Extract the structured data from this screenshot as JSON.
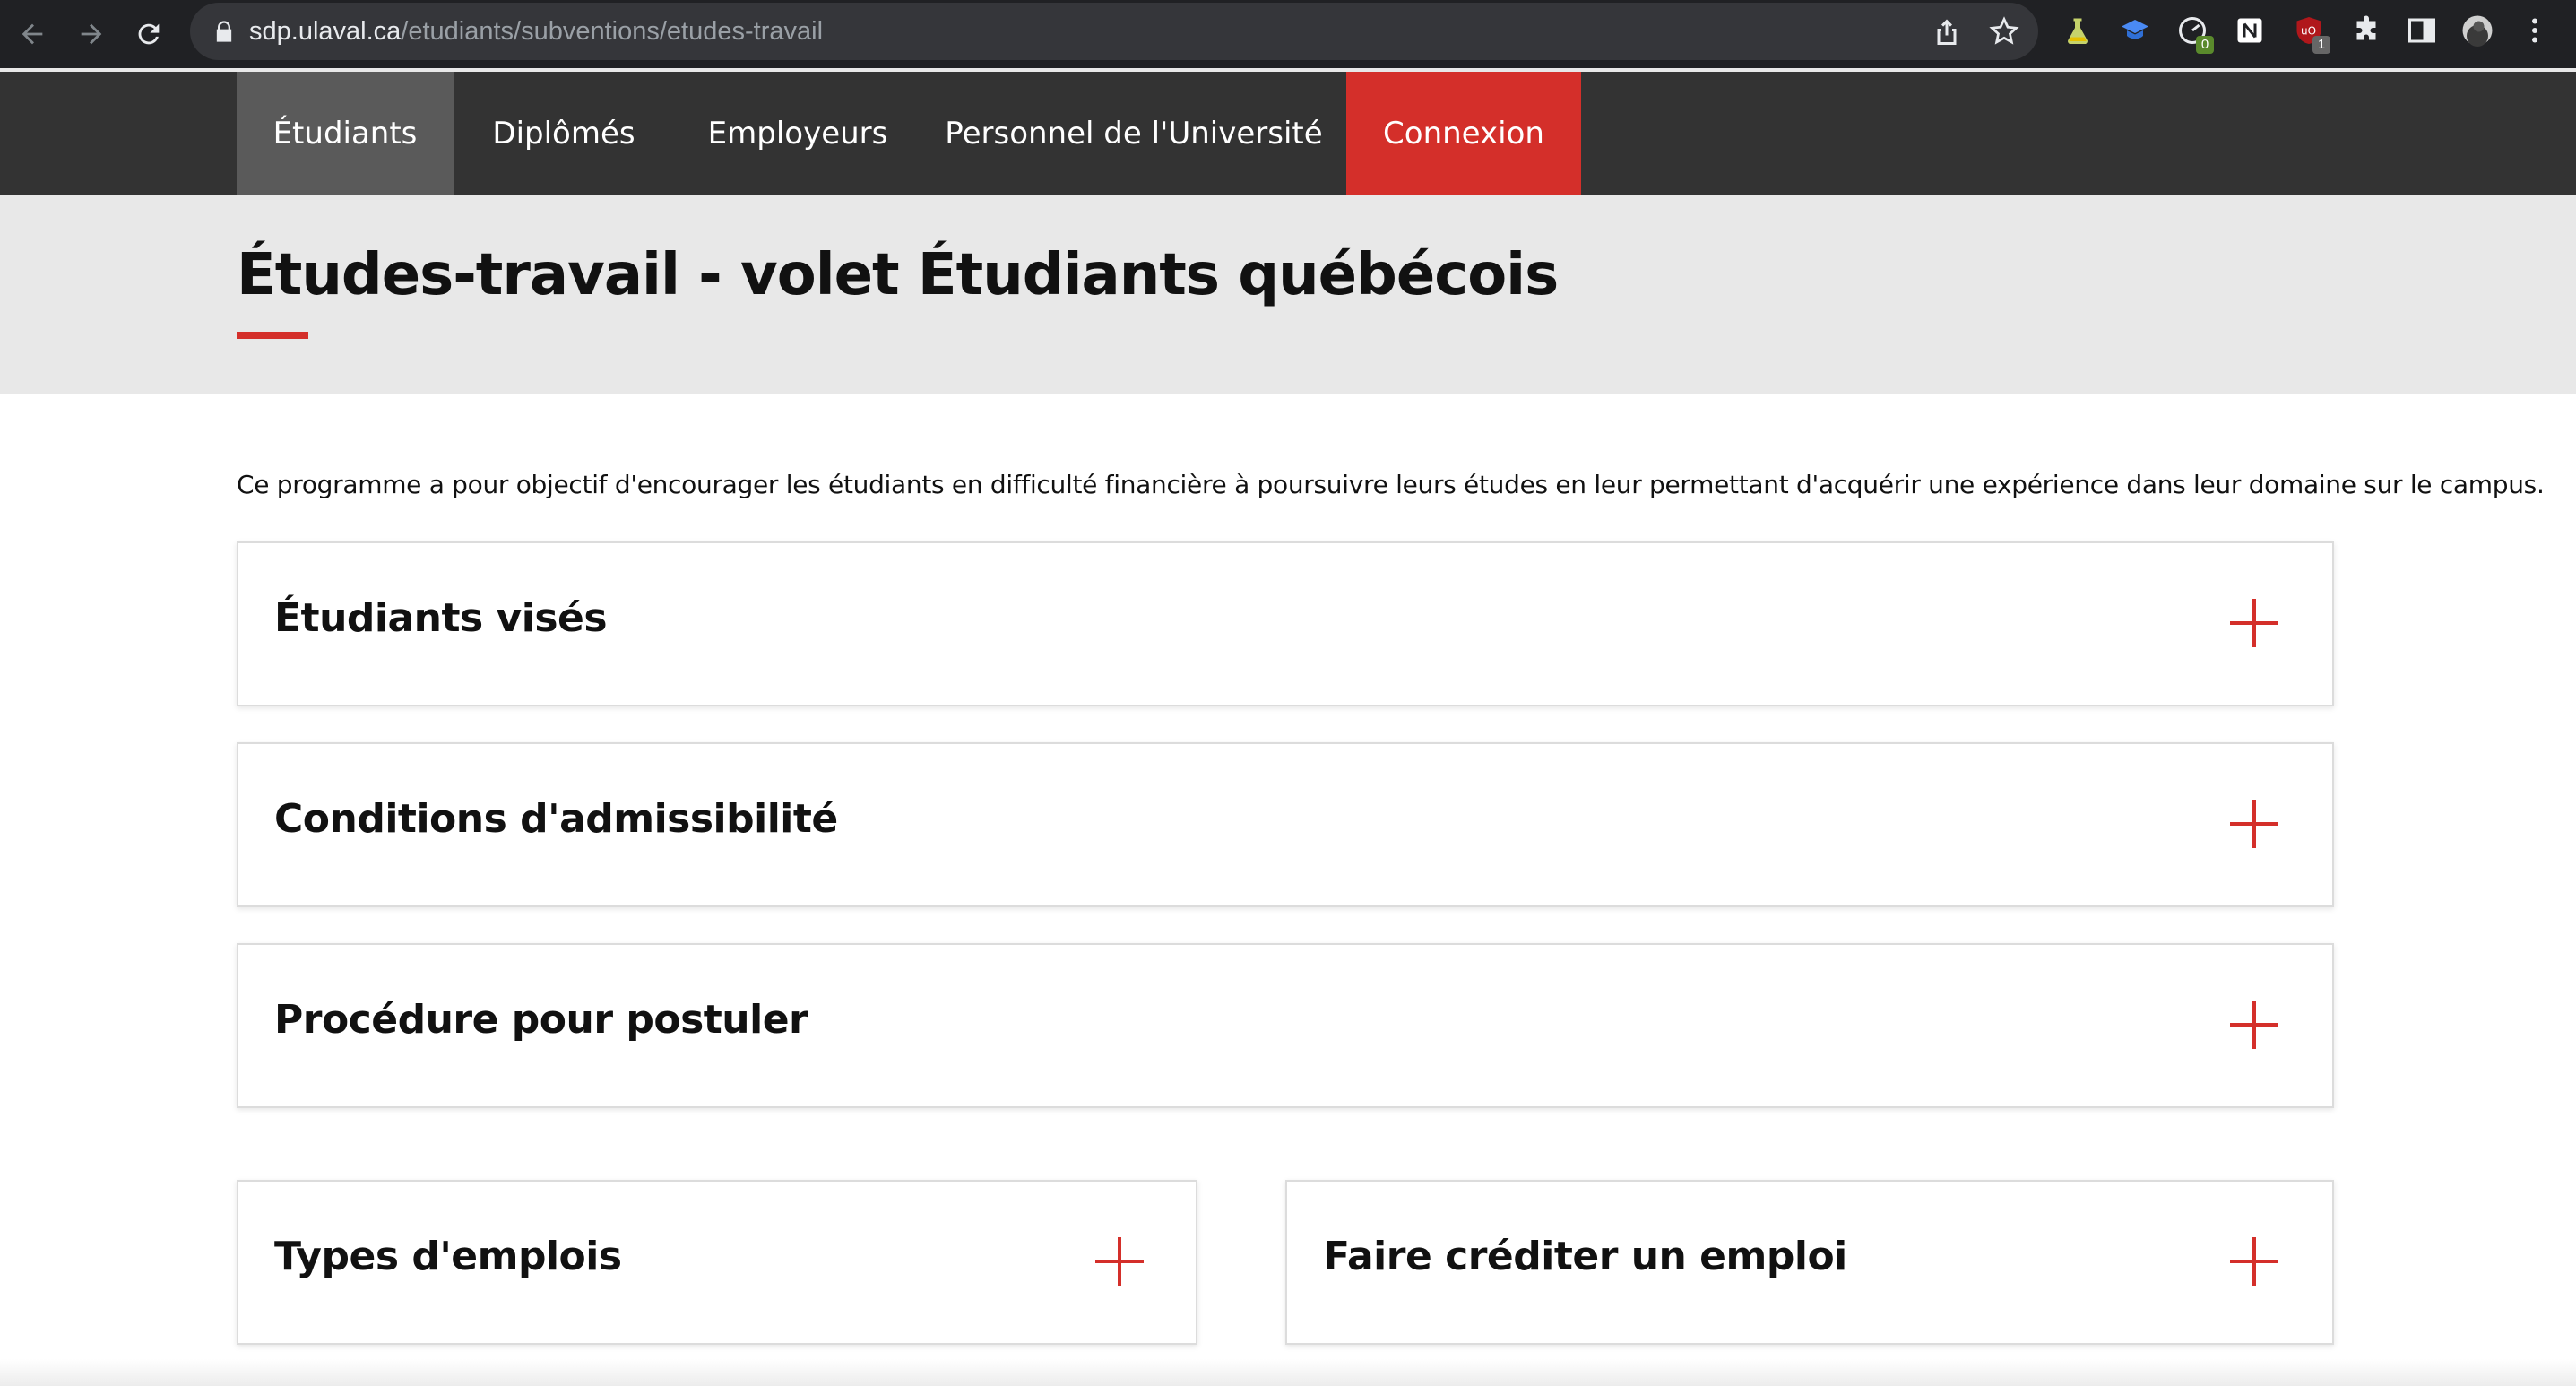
{
  "browser": {
    "url_host": "sdp.ulaval.ca",
    "url_path": "/etudiants/subventions/etudes-travail",
    "extensions": [
      {
        "name": "flask-extension-icon",
        "badge": ""
      },
      {
        "name": "graduation-cap-extension-icon",
        "badge": ""
      },
      {
        "name": "gauge-extension-icon",
        "badge": "0"
      },
      {
        "name": "notion-extension-icon",
        "badge": ""
      },
      {
        "name": "ublock-extension-icon",
        "badge": "1"
      }
    ]
  },
  "nav": {
    "items": [
      {
        "label": "Étudiants",
        "active": true
      },
      {
        "label": "Diplômés"
      },
      {
        "label": "Employeurs"
      },
      {
        "label": "Personnel de l'Université"
      }
    ],
    "login_label": "Connexion"
  },
  "page": {
    "title": "Études-travail - volet Étudiants québécois",
    "intro": "Ce programme a pour objectif d'encourager les étudiants en difficulté financière à poursuivre leurs études en leur permettant d'acquérir une expérience dans leur domaine sur le campus."
  },
  "accordions": [
    {
      "title": "Étudiants visés"
    },
    {
      "title": "Conditions d'admissibilité"
    },
    {
      "title": "Procédure pour postuler"
    },
    {
      "title": "Types d'emplois"
    },
    {
      "title": "Faire créditer un emploi"
    }
  ],
  "colors": {
    "accent": "#d42f2a",
    "nav_bg": "#333333",
    "nav_active": "#5a5a5a",
    "title_band": "#e8e8e8"
  }
}
